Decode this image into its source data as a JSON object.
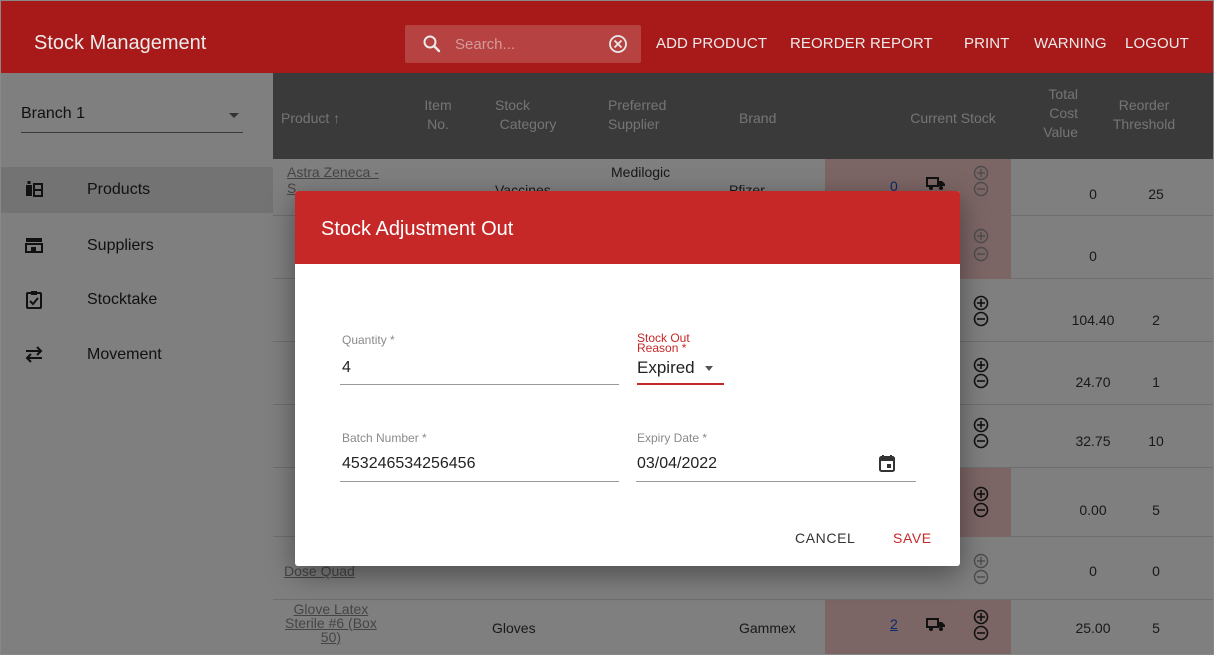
{
  "app": {
    "title": "Stock Management",
    "accent_color": "#b71c1c"
  },
  "search": {
    "placeholder": "Search...",
    "icon": "search-icon",
    "clear_icon": "clear-circle-icon"
  },
  "nav": {
    "add_product": "ADD PRODUCT",
    "reorder_report": "REORDER REPORT",
    "print": "PRINT",
    "warning": "WARNING",
    "logout": "LOGOUT"
  },
  "sidebar": {
    "branch": "Branch 1",
    "items": [
      {
        "label": "Products",
        "icon": "products-icon"
      },
      {
        "label": "Suppliers",
        "icon": "suppliers-icon"
      },
      {
        "label": "Stocktake",
        "icon": "stocktake-icon"
      },
      {
        "label": "Movement",
        "icon": "movement-icon"
      }
    ]
  },
  "table": {
    "headers": {
      "product": "Product ↑",
      "item_no_1": "Item",
      "item_no_2": "No.",
      "stock_category_1": "Stock",
      "stock_category_2": "Category",
      "preferred_supplier_1": "Preferred",
      "preferred_supplier_2": "Supplier",
      "brand": "Brand",
      "current_stock": "Current Stock",
      "total_cost_1": "Total",
      "total_cost_2": "Cost",
      "total_cost_3": "Value",
      "reorder_1": "Reorder",
      "reorder_2": "Threshold"
    },
    "rows": [
      {
        "product_1": "Astra Zeneca -",
        "product_2": "S",
        "category": "Vaccines",
        "supplier": "Medilogic",
        "brand": "Pfizer",
        "stock": "0",
        "total": "0",
        "threshold": "25"
      },
      {
        "product_1": "",
        "total": "0",
        "threshold": ""
      },
      {
        "total": "104.40",
        "threshold": "2"
      },
      {
        "total": "24.70",
        "threshold": "1"
      },
      {
        "total": "32.75",
        "threshold": "10"
      },
      {
        "total": "0.00",
        "threshold": "5"
      },
      {
        "product_2": "Dose Quad",
        "total": "0",
        "threshold": "0"
      },
      {
        "product_1": "Glove Latex",
        "product_2": "Sterile #6 (Box",
        "product_3": "50)",
        "category": "Gloves",
        "brand": "Gammex",
        "stock": "2",
        "total": "25.00",
        "threshold": "5"
      }
    ]
  },
  "dialog": {
    "title": "Stock Adjustment Out",
    "quantity": {
      "label": "Quantity *",
      "value": "4"
    },
    "reason": {
      "label_1": "Stock Out",
      "label_2": "Reason *",
      "value": "Expired"
    },
    "batch": {
      "label": "Batch Number *",
      "value": "453246534256456"
    },
    "expiry": {
      "label": "Expiry Date *",
      "value": "03/04/2022"
    },
    "cancel": "CANCEL",
    "save": "SAVE"
  }
}
